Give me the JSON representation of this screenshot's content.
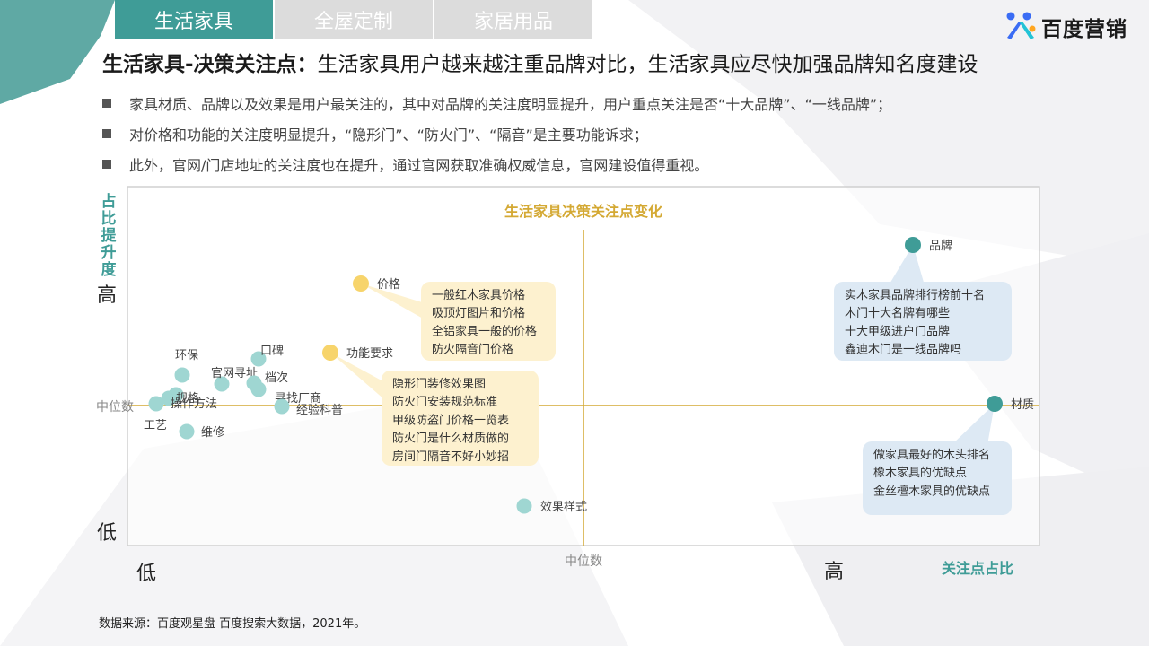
{
  "tabs": [
    {
      "label": "生活家具",
      "active": true
    },
    {
      "label": "全屋定制",
      "active": false
    },
    {
      "label": "家居用品",
      "active": false
    }
  ],
  "logo": {
    "text": "百度营销",
    "icon": "baidu-marketing-logo-icon"
  },
  "title": {
    "bold": "生活家具-决策关注点：",
    "rest": "生活家具用户越来越注重品牌对比，生活家具应尽快加强品牌知名度建设"
  },
  "bullets": [
    "家具材质、品牌以及效果是用户最关注的，其中对品牌的关注度明显提升，用户重点关注是否“十大品牌”、“一线品牌”；",
    "对价格和功能的关注度明显提升，“隐形门”、“防火门”、“隔音”是主要功能诉求；",
    "此外，官网/门店地址的关注度也在提升，通过官网获取准确权威信息，官网建设值得重视。"
  ],
  "source": "数据来源：百度观星盘  百度搜索大数据，2021年。",
  "colors": {
    "teal": "#3f9c97",
    "light_teal": "#9fd6d2",
    "gold": "#d4a934",
    "yellow": "#f7d46b",
    "grey_tab": "#dcdcdc"
  },
  "chart_data": {
    "type": "scatter",
    "title": "生活家具决策关注点变化",
    "y_axis_title": "占比提升度",
    "x_axis_title": "关注点占比",
    "y_high": "高",
    "y_low": "低",
    "x_low": "低",
    "x_high": "高",
    "y_median_label": "中位数",
    "x_median_label": "中位数",
    "xlim": [
      0,
      100
    ],
    "ylim": [
      0,
      100
    ],
    "x_median": 50,
    "y_median": 39,
    "points": [
      {
        "label": "品牌",
        "x": 86,
        "y": 84,
        "color": "teal"
      },
      {
        "label": "材质",
        "x": 95,
        "y": 39,
        "color": "teal"
      },
      {
        "label": "价格",
        "x": 25,
        "y": 73,
        "color": "yellow"
      },
      {
        "label": "功能要求",
        "x": 22,
        "y": 54,
        "color": "yellow"
      },
      {
        "label": "效果样式",
        "x": 43,
        "y": 11,
        "color": "light"
      },
      {
        "label": "口碑",
        "x": 14,
        "y": 52,
        "color": "light"
      },
      {
        "label": "环保",
        "x": 6,
        "y": 47,
        "color": "light"
      },
      {
        "label": "官网寻址",
        "x": 10,
        "y": 45,
        "color": "light"
      },
      {
        "label": "档次",
        "x": 14,
        "y": 44,
        "color": "light"
      },
      {
        "label": "规格",
        "x": 5,
        "y": 41,
        "color": "light"
      },
      {
        "label": "寻找厂商",
        "x": 14,
        "y": 43,
        "color": "light"
      },
      {
        "label": "操作方法",
        "x": 4,
        "y": 40,
        "color": "light"
      },
      {
        "label": "工艺",
        "x": 3,
        "y": 39,
        "color": "light"
      },
      {
        "label": "经验科普",
        "x": 17,
        "y": 39,
        "color": "light"
      },
      {
        "label": "维修",
        "x": 6,
        "y": 32,
        "color": "light"
      }
    ],
    "callouts": [
      {
        "for": "价格",
        "color": "yellow",
        "lines": [
          "一般红木家具价格",
          "吸顶灯图片和价格",
          "全铝家具一般的价格",
          "防火隔音门价格"
        ]
      },
      {
        "for": "功能要求",
        "color": "yellow",
        "lines": [
          "隐形门装修效果图",
          "防火门安装规范标准",
          "甲级防盗门价格一览表",
          "防火门是什么材质做的",
          "房间门隔音不好小妙招"
        ]
      },
      {
        "for": "品牌",
        "color": "blue",
        "lines": [
          "实木家具品牌排行榜前十名",
          "木门十大名牌有哪些",
          "十大甲级进户门品牌",
          "鑫迪木门是一线品牌吗"
        ]
      },
      {
        "for": "材质",
        "color": "blue",
        "lines": [
          "做家具最好的木头排名",
          "橡木家具的优缺点",
          "金丝檀木家具的优缺点"
        ]
      }
    ]
  }
}
